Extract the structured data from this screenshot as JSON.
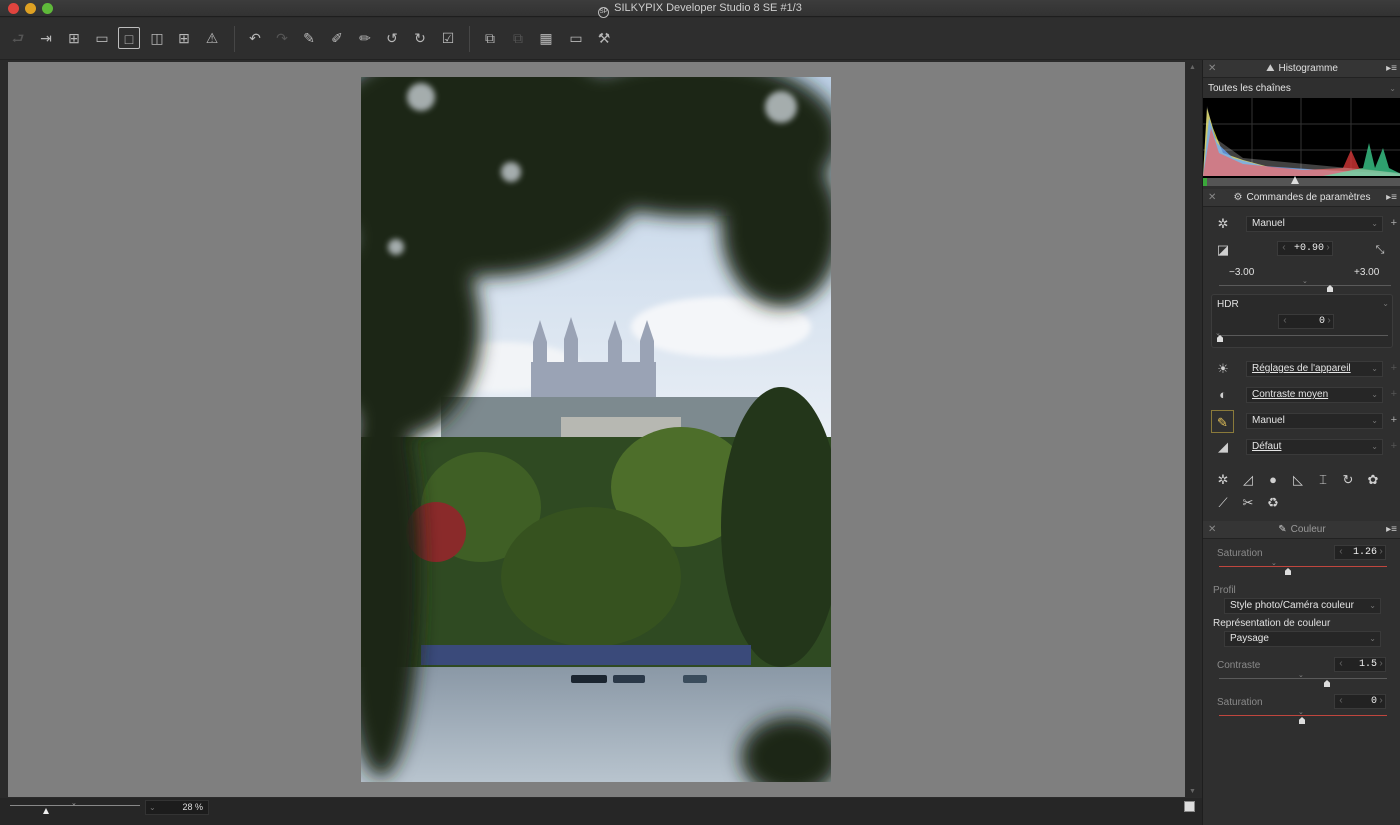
{
  "window": {
    "title": "SILKYPIX Developer Studio 8 SE   #1/3",
    "app_icon": "silkypix-logo-icon"
  },
  "toolbar": {
    "icons": [
      "back-icon",
      "forward-icon",
      "grid-view-icon",
      "filmstrip-view-icon",
      "single-view-icon",
      "compare-view-icon",
      "quad-view-icon",
      "warning-icon",
      "undo-icon",
      "redo-icon",
      "paste-params-icon",
      "copy-params-icon",
      "edit-params-icon",
      "rotate-left-icon",
      "rotate-right-icon",
      "mark-icon",
      "develop-icon",
      "batch-icon",
      "stamp-icon",
      "display-icon",
      "tools-icon"
    ]
  },
  "status": {
    "zoom_value": "28 %"
  },
  "histogram": {
    "title": "Histogramme",
    "channel": "Toutes les chaînes"
  },
  "params": {
    "title": "Commandes de paramètres",
    "wb_mode": "Manuel",
    "exposure_value": "+0.90",
    "exposure_min": "−3.00",
    "exposure_max": "+3.00",
    "exposure_level": 0.65,
    "hdr_label": "HDR",
    "hdr_value": "0",
    "camera_settings": "Réglages de l'appareil",
    "contrast_preset": "Contraste moyen",
    "color_mode": "Manuel",
    "sharpness_preset": "Défaut"
  },
  "color": {
    "title": "Couleur",
    "saturation_label": "Saturation",
    "saturation_value": "1.26",
    "profile_label": "Profil",
    "profile_value": "Style photo/Caméra couleur",
    "representation_label": "Représentation de couleur",
    "representation_value": "Paysage",
    "contrast_label": "Contraste",
    "contrast_value": "1.5",
    "saturation2_label": "Saturation",
    "saturation2_value": "0"
  },
  "colors": {
    "accent_red": "#c0463e",
    "active_icon": "#e3c15a"
  }
}
